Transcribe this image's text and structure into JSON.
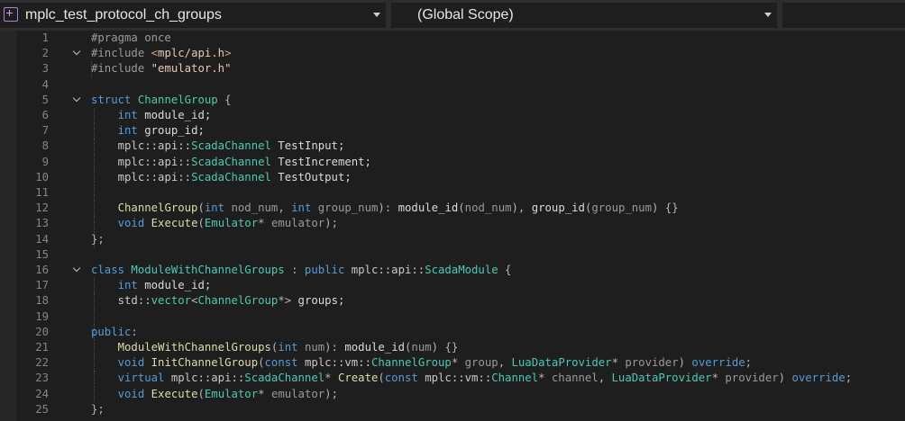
{
  "navbar": {
    "file_dropdown": "mplc_test_protocol_ch_groups",
    "scope_dropdown": "(Global Scope)"
  },
  "editor": {
    "lines": [
      {
        "n": "1",
        "fold": false,
        "guides": [],
        "t": [
          [
            "pp",
            "#pragma once"
          ]
        ]
      },
      {
        "n": "2",
        "fold": true,
        "guides": [],
        "t": [
          [
            "pp",
            "#include "
          ],
          [
            "inc",
            "<"
          ],
          [
            "st",
            "mplc/api.h"
          ],
          [
            "inc",
            ">"
          ]
        ]
      },
      {
        "n": "3",
        "fold": false,
        "guides": [
          101
        ],
        "t": [
          [
            "pp",
            "#include "
          ],
          [
            "st",
            "\"emulator.h\""
          ]
        ]
      },
      {
        "n": "4",
        "fold": false,
        "guides": [],
        "t": []
      },
      {
        "n": "5",
        "fold": true,
        "guides": [],
        "t": [
          [
            "kw",
            "struct "
          ],
          [
            "ty",
            "ChannelGroup"
          ],
          [
            "op",
            " {"
          ]
        ]
      },
      {
        "n": "6",
        "fold": false,
        "guides": [
          104
        ],
        "t": [
          [
            "",
            "    "
          ],
          [
            "kw",
            "int "
          ],
          [
            "",
            "module_id;"
          ]
        ]
      },
      {
        "n": "7",
        "fold": false,
        "guides": [
          104
        ],
        "t": [
          [
            "",
            "    "
          ],
          [
            "kw",
            "int "
          ],
          [
            "",
            "group_id;"
          ]
        ]
      },
      {
        "n": "8",
        "fold": false,
        "guides": [
          104
        ],
        "t": [
          [
            "",
            "    "
          ],
          [
            "ns",
            "mplc::api::"
          ],
          [
            "ty",
            "ScadaChannel"
          ],
          [
            "",
            " TestInput;"
          ]
        ]
      },
      {
        "n": "9",
        "fold": false,
        "guides": [
          104
        ],
        "t": [
          [
            "",
            "    "
          ],
          [
            "ns",
            "mplc::api::"
          ],
          [
            "ty",
            "ScadaChannel"
          ],
          [
            "",
            " TestIncrement;"
          ]
        ]
      },
      {
        "n": "10",
        "fold": false,
        "guides": [
          104
        ],
        "t": [
          [
            "",
            "    "
          ],
          [
            "ns",
            "mplc::api::"
          ],
          [
            "ty",
            "ScadaChannel"
          ],
          [
            "",
            " TestOutput;"
          ]
        ]
      },
      {
        "n": "11",
        "fold": false,
        "guides": [
          104
        ],
        "t": []
      },
      {
        "n": "12",
        "fold": false,
        "guides": [
          104
        ],
        "t": [
          [
            "",
            "    "
          ],
          [
            "fn",
            "ChannelGroup"
          ],
          [
            "op",
            "("
          ],
          [
            "kw",
            "int "
          ],
          [
            "pa",
            "nod_num"
          ],
          [
            "op",
            ", "
          ],
          [
            "kw",
            "int "
          ],
          [
            "pa",
            "group_num"
          ],
          [
            "op",
            "): "
          ],
          [
            "",
            "module_id"
          ],
          [
            "op",
            "("
          ],
          [
            "pa",
            "nod_num"
          ],
          [
            "op",
            "), "
          ],
          [
            "",
            "group_id"
          ],
          [
            "op",
            "("
          ],
          [
            "pa",
            "group_num"
          ],
          [
            "op",
            ") {}"
          ]
        ]
      },
      {
        "n": "13",
        "fold": false,
        "guides": [
          104
        ],
        "t": [
          [
            "",
            "    "
          ],
          [
            "kw",
            "void "
          ],
          [
            "fn",
            "Execute"
          ],
          [
            "op",
            "("
          ],
          [
            "ty",
            "Emulator"
          ],
          [
            "op",
            "* "
          ],
          [
            "pa",
            "emulator"
          ],
          [
            "op",
            ");"
          ]
        ]
      },
      {
        "n": "14",
        "fold": false,
        "guides": [
          104
        ],
        "t": [
          [
            "op",
            "};"
          ]
        ]
      },
      {
        "n": "15",
        "fold": false,
        "guides": [],
        "t": []
      },
      {
        "n": "16",
        "fold": true,
        "guides": [],
        "t": [
          [
            "kw",
            "class "
          ],
          [
            "ty",
            "ModuleWithChannelGroups"
          ],
          [
            "op",
            " : "
          ],
          [
            "kw",
            "public "
          ],
          [
            "ns",
            "mplc::api::"
          ],
          [
            "ty",
            "ScadaModule"
          ],
          [
            "op",
            " {"
          ]
        ]
      },
      {
        "n": "17",
        "fold": false,
        "guides": [
          104
        ],
        "t": [
          [
            "",
            "    "
          ],
          [
            "kw",
            "int "
          ],
          [
            "",
            "module_id;"
          ]
        ]
      },
      {
        "n": "18",
        "fold": false,
        "guides": [
          104
        ],
        "t": [
          [
            "",
            "    "
          ],
          [
            "ns",
            "std::"
          ],
          [
            "ty",
            "vector"
          ],
          [
            "op",
            "<"
          ],
          [
            "ty",
            "ChannelGroup"
          ],
          [
            "op",
            "*> "
          ],
          [
            "",
            "groups;"
          ]
        ]
      },
      {
        "n": "19",
        "fold": false,
        "guides": [
          104
        ],
        "t": []
      },
      {
        "n": "20",
        "fold": false,
        "guides": [
          104
        ],
        "t": [
          [
            "kw",
            "public"
          ],
          [
            "op",
            ":"
          ]
        ]
      },
      {
        "n": "21",
        "fold": false,
        "guides": [
          104
        ],
        "t": [
          [
            "",
            "    "
          ],
          [
            "fn",
            "ModuleWithChannelGroups"
          ],
          [
            "op",
            "("
          ],
          [
            "kw",
            "int "
          ],
          [
            "pa",
            "num"
          ],
          [
            "op",
            "): "
          ],
          [
            "",
            "module_id"
          ],
          [
            "op",
            "("
          ],
          [
            "pa",
            "num"
          ],
          [
            "op",
            ") {}"
          ]
        ]
      },
      {
        "n": "22",
        "fold": false,
        "guides": [
          104
        ],
        "t": [
          [
            "",
            "    "
          ],
          [
            "kw",
            "void "
          ],
          [
            "fn",
            "InitChannelGroup"
          ],
          [
            "op",
            "("
          ],
          [
            "kw",
            "const "
          ],
          [
            "ns",
            "mplc::vm::"
          ],
          [
            "ty",
            "ChannelGroup"
          ],
          [
            "op",
            "* "
          ],
          [
            "pa",
            "group"
          ],
          [
            "op",
            ", "
          ],
          [
            "ty",
            "LuaDataProvider"
          ],
          [
            "op",
            "* "
          ],
          [
            "pa",
            "provider"
          ],
          [
            "op",
            ") "
          ],
          [
            "kw",
            "override"
          ],
          [
            "op",
            ";"
          ]
        ]
      },
      {
        "n": "23",
        "fold": false,
        "guides": [
          104
        ],
        "t": [
          [
            "",
            "    "
          ],
          [
            "kw",
            "virtual "
          ],
          [
            "ns",
            "mplc::api::"
          ],
          [
            "ty",
            "ScadaChannel"
          ],
          [
            "op",
            "* "
          ],
          [
            "fn",
            "Create"
          ],
          [
            "op",
            "("
          ],
          [
            "kw",
            "const "
          ],
          [
            "ns",
            "mplc::vm::"
          ],
          [
            "ty",
            "Channel"
          ],
          [
            "op",
            "* "
          ],
          [
            "pa",
            "channel"
          ],
          [
            "op",
            ", "
          ],
          [
            "ty",
            "LuaDataProvider"
          ],
          [
            "op",
            "* "
          ],
          [
            "pa",
            "provider"
          ],
          [
            "op",
            ") "
          ],
          [
            "kw",
            "override"
          ],
          [
            "op",
            ";"
          ]
        ]
      },
      {
        "n": "24",
        "fold": false,
        "guides": [
          104
        ],
        "t": [
          [
            "",
            "    "
          ],
          [
            "kw",
            "void "
          ],
          [
            "fn",
            "Execute"
          ],
          [
            "op",
            "("
          ],
          [
            "ty",
            "Emulator"
          ],
          [
            "op",
            "* "
          ],
          [
            "pa",
            "emulator"
          ],
          [
            "op",
            ");"
          ]
        ]
      },
      {
        "n": "25",
        "fold": false,
        "guides": [],
        "t": [
          [
            "op",
            "};"
          ]
        ]
      }
    ]
  }
}
